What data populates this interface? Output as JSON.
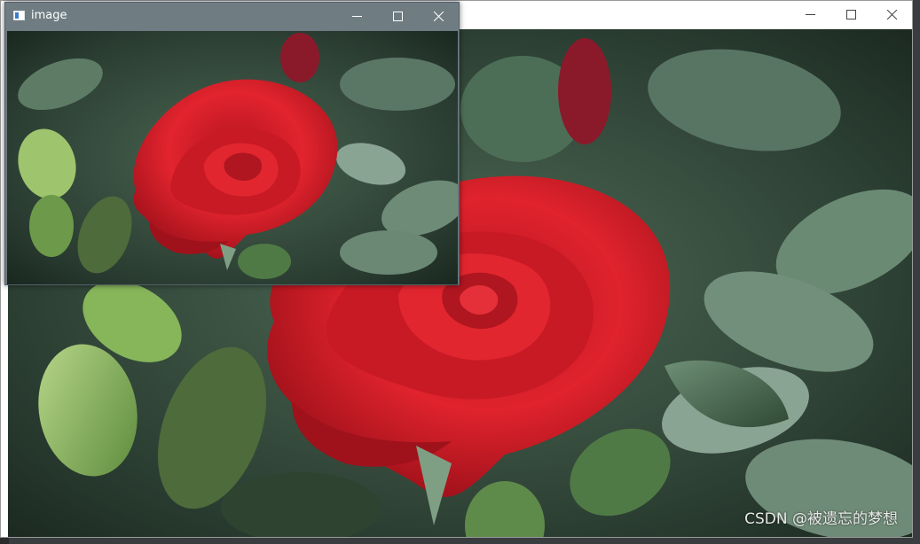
{
  "front_window": {
    "title": "image",
    "controls": [
      "minimize",
      "maximize",
      "close"
    ]
  },
  "back_window": {
    "title": "",
    "controls": [
      "minimize",
      "maximize",
      "close"
    ]
  },
  "image": {
    "subject": "red-rose-with-green-leaves",
    "watermark": "CSDN @被遗忘的梦想"
  },
  "colors": {
    "front_titlebar": "#6f7d83",
    "back_titlebar": "#ffffff",
    "rose_red": "#d91f2a",
    "leaf_green": "#3d5a3a"
  },
  "icons": {
    "app_icon": "app-window-icon",
    "minimize": "minimize-icon",
    "maximize": "maximize-icon",
    "close": "close-icon"
  }
}
